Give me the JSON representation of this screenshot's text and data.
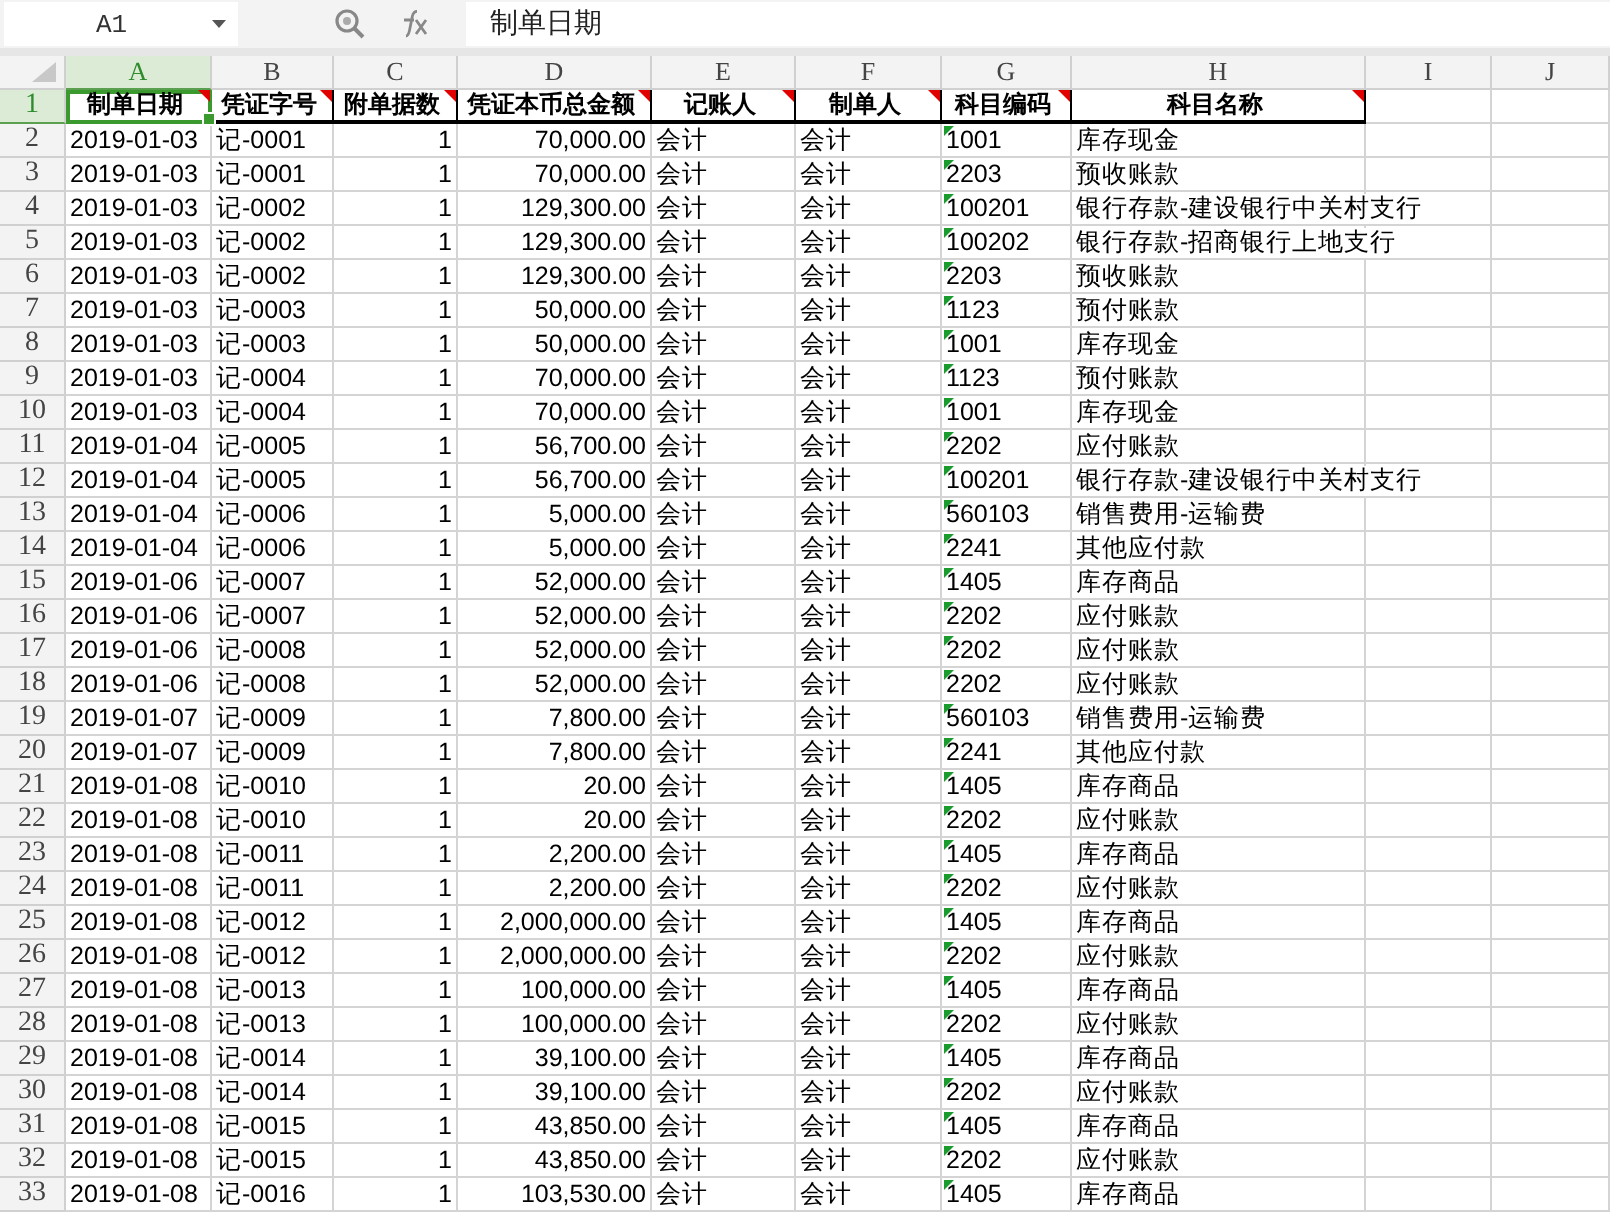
{
  "formula_bar": {
    "name_box": "A1",
    "formula": "制单日期"
  },
  "columns": [
    {
      "letter": "A",
      "kind": "text",
      "selected": true,
      "error_marker": false
    },
    {
      "letter": "B",
      "kind": "text",
      "selected": false,
      "error_marker": false
    },
    {
      "letter": "C",
      "kind": "number",
      "selected": false,
      "error_marker": false
    },
    {
      "letter": "D",
      "kind": "number",
      "selected": false,
      "error_marker": false
    },
    {
      "letter": "E",
      "kind": "text",
      "selected": false,
      "error_marker": false
    },
    {
      "letter": "F",
      "kind": "text",
      "selected": false,
      "error_marker": false
    },
    {
      "letter": "G",
      "kind": "text",
      "selected": false,
      "error_marker": true
    },
    {
      "letter": "H",
      "kind": "text",
      "selected": false,
      "error_marker": false
    },
    {
      "letter": "I",
      "selected": false,
      "error_marker": false
    },
    {
      "letter": "J",
      "selected": false,
      "error_marker": false
    }
  ],
  "rows": [
    {
      "num": "1",
      "kind": "header",
      "selected": true,
      "cells": [
        "制单日期",
        "凭证字号",
        "附单据数",
        "凭证本币总金额",
        "记账人",
        "制单人",
        "科目编码",
        "科目名称"
      ]
    },
    {
      "num": "2",
      "kind": "data",
      "selected": false,
      "cells": [
        "2019-01-03",
        "记-0001",
        "1",
        "70,000.00",
        "会计",
        "会计",
        "1001",
        "库存现金"
      ]
    },
    {
      "num": "3",
      "kind": "data",
      "selected": false,
      "cells": [
        "2019-01-03",
        "记-0001",
        "1",
        "70,000.00",
        "会计",
        "会计",
        "2203",
        "预收账款"
      ]
    },
    {
      "num": "4",
      "kind": "data",
      "selected": false,
      "cells": [
        "2019-01-03",
        "记-0002",
        "1",
        "129,300.00",
        "会计",
        "会计",
        "100201",
        "银行存款-建设银行中关村支行"
      ]
    },
    {
      "num": "5",
      "kind": "data",
      "selected": false,
      "cells": [
        "2019-01-03",
        "记-0002",
        "1",
        "129,300.00",
        "会计",
        "会计",
        "100202",
        "银行存款-招商银行上地支行"
      ]
    },
    {
      "num": "6",
      "kind": "data",
      "selected": false,
      "cells": [
        "2019-01-03",
        "记-0002",
        "1",
        "129,300.00",
        "会计",
        "会计",
        "2203",
        "预收账款"
      ]
    },
    {
      "num": "7",
      "kind": "data",
      "selected": false,
      "cells": [
        "2019-01-03",
        "记-0003",
        "1",
        "50,000.00",
        "会计",
        "会计",
        "1123",
        "预付账款"
      ]
    },
    {
      "num": "8",
      "kind": "data",
      "selected": false,
      "cells": [
        "2019-01-03",
        "记-0003",
        "1",
        "50,000.00",
        "会计",
        "会计",
        "1001",
        "库存现金"
      ]
    },
    {
      "num": "9",
      "kind": "data",
      "selected": false,
      "cells": [
        "2019-01-03",
        "记-0004",
        "1",
        "70,000.00",
        "会计",
        "会计",
        "1123",
        "预付账款"
      ]
    },
    {
      "num": "10",
      "kind": "data",
      "selected": false,
      "cells": [
        "2019-01-03",
        "记-0004",
        "1",
        "70,000.00",
        "会计",
        "会计",
        "1001",
        "库存现金"
      ]
    },
    {
      "num": "11",
      "kind": "data",
      "selected": false,
      "cells": [
        "2019-01-04",
        "记-0005",
        "1",
        "56,700.00",
        "会计",
        "会计",
        "2202",
        "应付账款"
      ]
    },
    {
      "num": "12",
      "kind": "data",
      "selected": false,
      "cells": [
        "2019-01-04",
        "记-0005",
        "1",
        "56,700.00",
        "会计",
        "会计",
        "100201",
        "银行存款-建设银行中关村支行"
      ]
    },
    {
      "num": "13",
      "kind": "data",
      "selected": false,
      "cells": [
        "2019-01-04",
        "记-0006",
        "1",
        "5,000.00",
        "会计",
        "会计",
        "560103",
        "销售费用-运输费"
      ]
    },
    {
      "num": "14",
      "kind": "data",
      "selected": false,
      "cells": [
        "2019-01-04",
        "记-0006",
        "1",
        "5,000.00",
        "会计",
        "会计",
        "2241",
        "其他应付款"
      ]
    },
    {
      "num": "15",
      "kind": "data",
      "selected": false,
      "cells": [
        "2019-01-06",
        "记-0007",
        "1",
        "52,000.00",
        "会计",
        "会计",
        "1405",
        "库存商品"
      ]
    },
    {
      "num": "16",
      "kind": "data",
      "selected": false,
      "cells": [
        "2019-01-06",
        "记-0007",
        "1",
        "52,000.00",
        "会计",
        "会计",
        "2202",
        "应付账款"
      ]
    },
    {
      "num": "17",
      "kind": "data",
      "selected": false,
      "cells": [
        "2019-01-06",
        "记-0008",
        "1",
        "52,000.00",
        "会计",
        "会计",
        "2202",
        "应付账款"
      ]
    },
    {
      "num": "18",
      "kind": "data",
      "selected": false,
      "cells": [
        "2019-01-06",
        "记-0008",
        "1",
        "52,000.00",
        "会计",
        "会计",
        "2202",
        "应付账款"
      ]
    },
    {
      "num": "19",
      "kind": "data",
      "selected": false,
      "cells": [
        "2019-01-07",
        "记-0009",
        "1",
        "7,800.00",
        "会计",
        "会计",
        "560103",
        "销售费用-运输费"
      ]
    },
    {
      "num": "20",
      "kind": "data",
      "selected": false,
      "cells": [
        "2019-01-07",
        "记-0009",
        "1",
        "7,800.00",
        "会计",
        "会计",
        "2241",
        "其他应付款"
      ]
    },
    {
      "num": "21",
      "kind": "data",
      "selected": false,
      "cells": [
        "2019-01-08",
        "记-0010",
        "1",
        "20.00",
        "会计",
        "会计",
        "1405",
        "库存商品"
      ]
    },
    {
      "num": "22",
      "kind": "data",
      "selected": false,
      "cells": [
        "2019-01-08",
        "记-0010",
        "1",
        "20.00",
        "会计",
        "会计",
        "2202",
        "应付账款"
      ]
    },
    {
      "num": "23",
      "kind": "data",
      "selected": false,
      "cells": [
        "2019-01-08",
        "记-0011",
        "1",
        "2,200.00",
        "会计",
        "会计",
        "1405",
        "库存商品"
      ]
    },
    {
      "num": "24",
      "kind": "data",
      "selected": false,
      "cells": [
        "2019-01-08",
        "记-0011",
        "1",
        "2,200.00",
        "会计",
        "会计",
        "2202",
        "应付账款"
      ]
    },
    {
      "num": "25",
      "kind": "data",
      "selected": false,
      "cells": [
        "2019-01-08",
        "记-0012",
        "1",
        "2,000,000.00",
        "会计",
        "会计",
        "1405",
        "库存商品"
      ]
    },
    {
      "num": "26",
      "kind": "data",
      "selected": false,
      "cells": [
        "2019-01-08",
        "记-0012",
        "1",
        "2,000,000.00",
        "会计",
        "会计",
        "2202",
        "应付账款"
      ]
    },
    {
      "num": "27",
      "kind": "data",
      "selected": false,
      "cells": [
        "2019-01-08",
        "记-0013",
        "1",
        "100,000.00",
        "会计",
        "会计",
        "1405",
        "库存商品"
      ]
    },
    {
      "num": "28",
      "kind": "data",
      "selected": false,
      "cells": [
        "2019-01-08",
        "记-0013",
        "1",
        "100,000.00",
        "会计",
        "会计",
        "2202",
        "应付账款"
      ]
    },
    {
      "num": "29",
      "kind": "data",
      "selected": false,
      "cells": [
        "2019-01-08",
        "记-0014",
        "1",
        "39,100.00",
        "会计",
        "会计",
        "1405",
        "库存商品"
      ]
    },
    {
      "num": "30",
      "kind": "data",
      "selected": false,
      "cells": [
        "2019-01-08",
        "记-0014",
        "1",
        "39,100.00",
        "会计",
        "会计",
        "2202",
        "应付账款"
      ]
    },
    {
      "num": "31",
      "kind": "data",
      "selected": false,
      "cells": [
        "2019-01-08",
        "记-0015",
        "1",
        "43,850.00",
        "会计",
        "会计",
        "1405",
        "库存商品"
      ]
    },
    {
      "num": "32",
      "kind": "data",
      "selected": false,
      "cells": [
        "2019-01-08",
        "记-0015",
        "1",
        "43,850.00",
        "会计",
        "会计",
        "2202",
        "应付账款"
      ]
    },
    {
      "num": "33",
      "kind": "data",
      "selected": false,
      "cells": [
        "2019-01-08",
        "记-0016",
        "1",
        "103,530.00",
        "会计",
        "会计",
        "1405",
        "库存商品"
      ]
    }
  ]
}
